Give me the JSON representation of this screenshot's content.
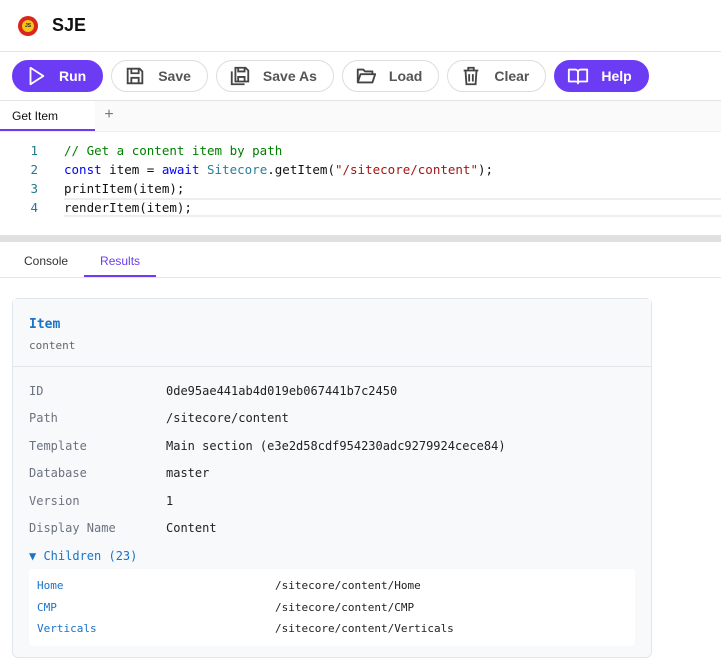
{
  "app": {
    "title": "SJE",
    "logo_text": "JS"
  },
  "toolbar": {
    "run": "Run",
    "save": "Save",
    "save_as": "Save As",
    "load": "Load",
    "clear": "Clear",
    "help": "Help"
  },
  "editor_tabs": {
    "active": "Get Item",
    "add": "+"
  },
  "code": [
    {
      "n": "1"
    },
    {
      "n": "2"
    },
    {
      "n": "3"
    },
    {
      "n": "4"
    }
  ],
  "code_tokens": {
    "l1": "// Get a content item by path",
    "l2a": "const",
    "l2b": " item = ",
    "l2c": "await",
    "l2d": " ",
    "l2e": "Sitecore",
    ".l2f": "",
    "l2g": ".getItem(",
    "l2h": "\"/sitecore/content\"",
    "l2i": ");",
    "l3": "printItem(item);",
    "l4": "renderItem(item);"
  },
  "result_tabs": {
    "console": "Console",
    "results": "Results"
  },
  "item": {
    "title": "Item",
    "subtitle": "content",
    "fields": [
      {
        "k": "ID",
        "v": "0de95ae441ab4d019eb067441b7c2450"
      },
      {
        "k": "Path",
        "v": "/sitecore/content"
      },
      {
        "k": "Template",
        "v": "Main section (e3e2d58cdf954230adc9279924cece84)"
      },
      {
        "k": "Database",
        "v": "master"
      },
      {
        "k": "Version",
        "v": "1"
      },
      {
        "k": "Display Name",
        "v": "Content"
      }
    ],
    "children_label": "▼ Children (23)",
    "children": [
      {
        "n": "Home",
        "p": "/sitecore/content/Home"
      },
      {
        "n": "CMP",
        "p": "/sitecore/content/CMP"
      },
      {
        "n": "Verticals",
        "p": "/sitecore/content/Verticals"
      }
    ]
  },
  "colors": {
    "accent": "#6c3cf5",
    "link": "#1a73c8"
  }
}
